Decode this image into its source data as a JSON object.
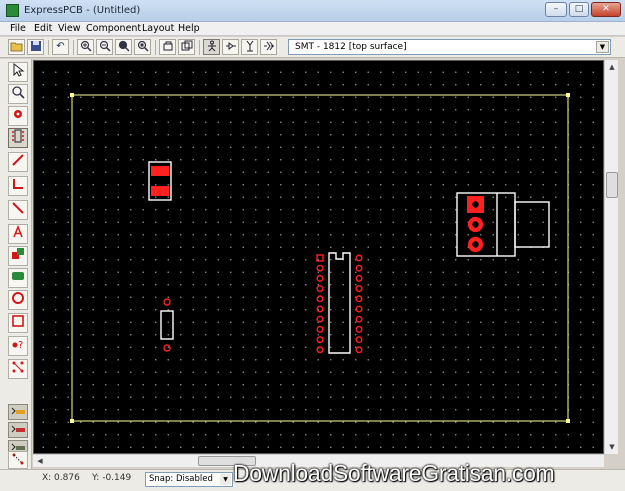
{
  "window": {
    "title": "ExpressPCB - (Untitled)",
    "minimize": "–",
    "maximize": "□",
    "close": "✕"
  },
  "menu": [
    "File",
    "Edit",
    "View",
    "Component",
    "Layout",
    "Help"
  ],
  "toolbar": {
    "icons": [
      "open-icon",
      "save-icon",
      "undo-icon",
      "zoom-in-icon",
      "zoom-out-icon",
      "zoom-fit-icon",
      "zoom-window-icon",
      "rotate-icon",
      "flip-icon",
      "component-icon",
      "pin-icon",
      "via-icon",
      "pad-icon"
    ],
    "component_select": "SMT - 1812  [top surface]"
  },
  "left_tools": [
    "pointer-icon",
    "zoom-select-icon",
    "pad-place-icon",
    "component-place-icon",
    "trace-icon",
    "corner-trace-icon",
    "diagonal-trace-icon",
    "text-icon",
    "fill-icon",
    "jumper-icon",
    "circle-icon",
    "rect-icon",
    "question-icon",
    "multilayer-icon"
  ],
  "layer_buttons": [
    "layer-top-icon",
    "layer-bottom-icon",
    "layer-silk-icon",
    "layer-ratsnest-icon"
  ],
  "status": {
    "x": "X: 0.876",
    "y": "Y: -0.149",
    "snap": "Snap: Disabled"
  },
  "watermark": "DownloadSoftwareGratisan.com",
  "colors": {
    "canvas": "#000000",
    "board_outline": "#ffff99",
    "silkscreen": "#ffffff",
    "copper": "#ff2020",
    "grid_dot": "#8a8a8a"
  }
}
